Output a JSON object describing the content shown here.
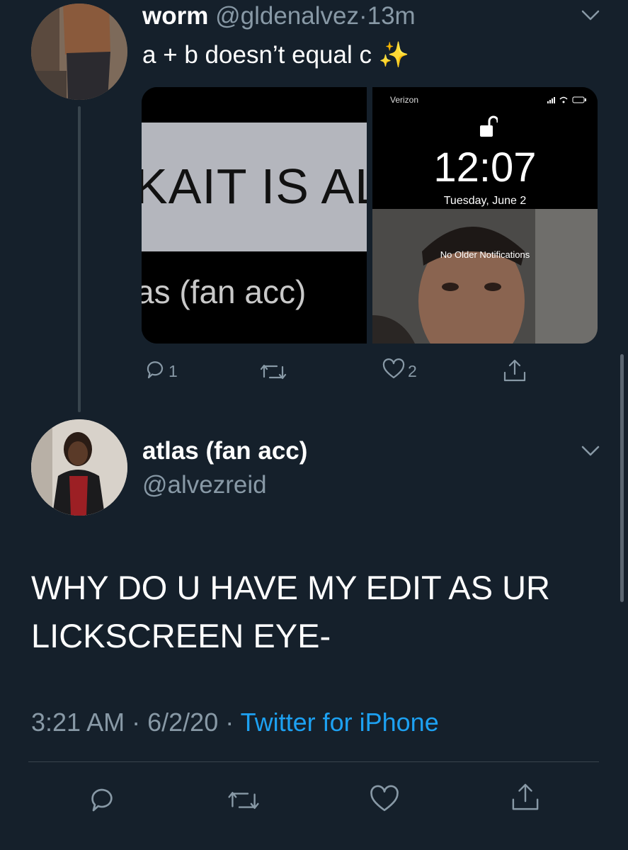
{
  "tweet1": {
    "display_name": "worm",
    "handle": "@gldenalvez",
    "separator": "·",
    "time": "13m",
    "text": "a + b doesn’t equal c",
    "emoji": "✨",
    "media_left": {
      "banner_text": "KAIT IS AL",
      "subtitle_text": "as (fan acc)"
    },
    "media_right": {
      "carrier": "Verizon",
      "clock": "12:07",
      "date": "Tuesday, June 2",
      "notice": "No Older Notifications"
    },
    "actions": {
      "reply_count": "1",
      "like_count": "2"
    }
  },
  "tweet2": {
    "display_name": "atlas (fan acc)",
    "handle": "@alvezreid",
    "text_line1": "WHY DO U HAVE MY EDIT AS UR",
    "text_line2": "LICKSCREEN EYE-",
    "time": "3:21 AM",
    "date": "6/2/20",
    "separator": "·",
    "source": "Twitter for iPhone"
  },
  "colors": {
    "background": "#15202b",
    "link": "#1da1f2",
    "muted": "#8899a6",
    "divider": "#38444d"
  }
}
